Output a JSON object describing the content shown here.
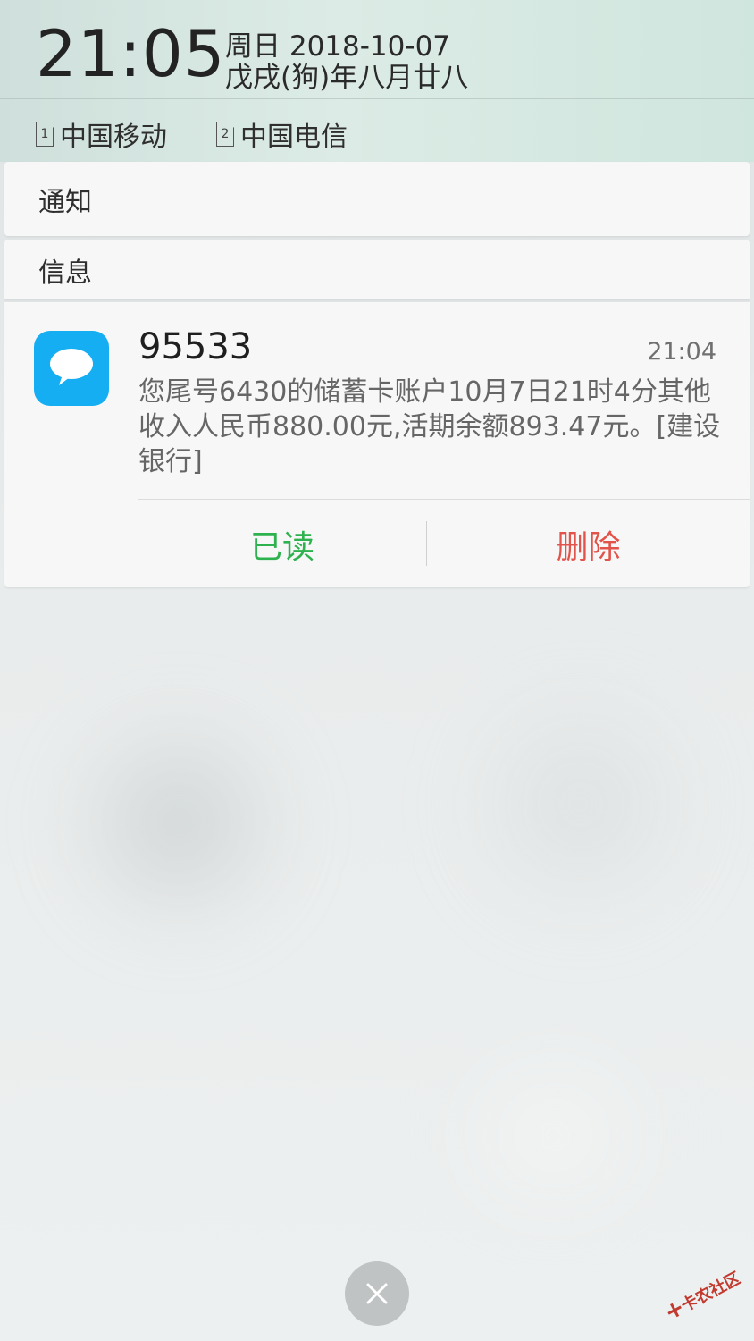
{
  "status": {
    "time": "21:05",
    "date": "周日 2018-10-07",
    "lunar": "戊戌(狗)年八月廿八"
  },
  "carriers": [
    {
      "sim_label": "1",
      "name": "中国移动"
    },
    {
      "sim_label": "2",
      "name": "中国电信"
    }
  ],
  "sections": {
    "notice": "通知",
    "message": "信息"
  },
  "message": {
    "sender": "95533",
    "time": "21:04",
    "body": "您尾号6430的储蓄卡账户10月7日21时4分其他收入人民币880.00元,活期余额893.47元。[建设银行]",
    "app_icon": "message-bubble-icon",
    "actions": {
      "read": "已读",
      "delete": "删除"
    }
  },
  "watermark": "卡农社区",
  "colors": {
    "accent_green": "#2eb24f",
    "accent_red": "#e2544b",
    "message_icon_blue": "#16aef2"
  }
}
